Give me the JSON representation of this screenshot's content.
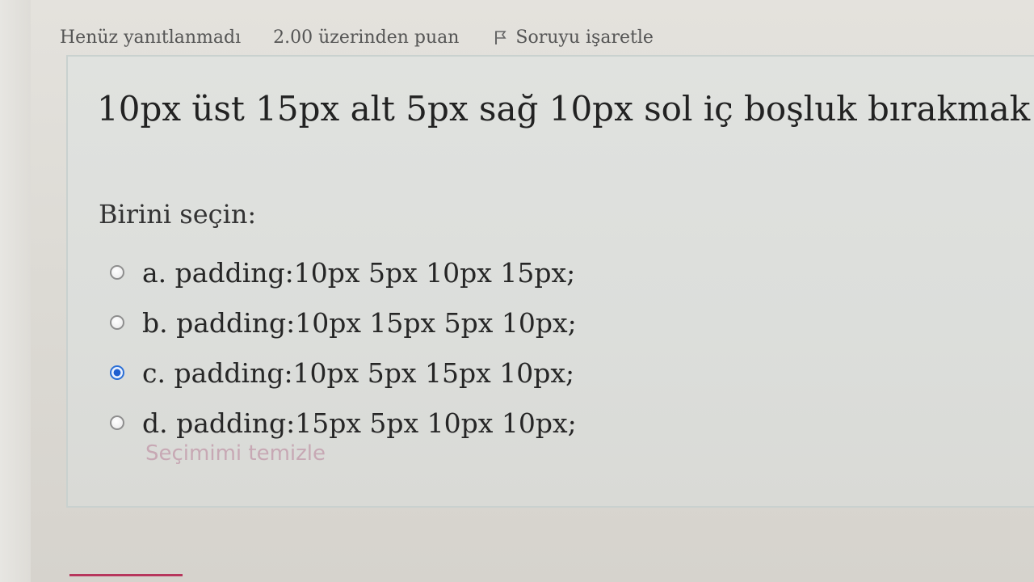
{
  "info": {
    "state": "Henüz yanıtlanmadı",
    "grade": "2.00 üzerinden puan",
    "flag_label": "Soruyu işaretle"
  },
  "question": {
    "text": "10px üst 15px alt 5px sağ 10px sol iç boşluk bırakmak",
    "prompt": "Birini seçin:",
    "answers": [
      {
        "label": "a. padding:10px 5px 10px 15px;",
        "selected": false
      },
      {
        "label": "b. padding:10px 15px 5px 10px;",
        "selected": false
      },
      {
        "label": "c. padding:10px 5px 15px 10px;",
        "selected": true
      },
      {
        "label": "d. padding:15px 5px 10px 10px;",
        "selected": false
      }
    ],
    "clear_label": "Seçimimi temizle"
  },
  "colors": {
    "accent": "#1f5fd0",
    "clear_link": "#c7a8b4",
    "border": "#c9d1cf"
  }
}
